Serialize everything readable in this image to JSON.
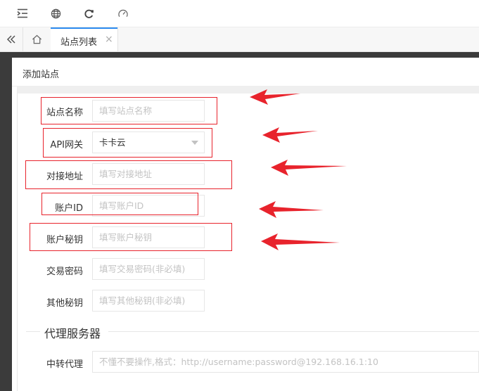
{
  "toolbar": {
    "icons": [
      "menu-indent-icon",
      "globe-icon",
      "refresh-icon",
      "dashboard-gauge-icon"
    ]
  },
  "tabs": {
    "active_label": "站点列表",
    "close_symbol": "×"
  },
  "modal": {
    "title": "添加站点",
    "fields": {
      "site_name": {
        "label": "站点名称",
        "placeholder": "填写站点名称"
      },
      "api_gateway": {
        "label": "API网关",
        "value": "卡卡云"
      },
      "endpoint": {
        "label": "对接地址",
        "placeholder": "填写对接地址"
      },
      "account_id": {
        "label": "账户ID",
        "placeholder": "填写账户ID"
      },
      "account_key": {
        "label": "账户秘钥",
        "placeholder": "填写账户秘钥"
      },
      "trade_password": {
        "label": "交易密码",
        "placeholder": "填写交易密码(非必填)"
      },
      "other_key": {
        "label": "其他秘钥",
        "placeholder": "填写其他秘钥(非必填)"
      }
    },
    "proxy_section": {
      "title": "代理服务器",
      "relay": {
        "label": "中转代理",
        "placeholder": "不懂不要操作,格式：http://username:password@192.168.16.1:10"
      }
    }
  },
  "colors": {
    "highlight_red": "#e8232c",
    "accent_blue": "#2d8cf0",
    "backdrop": "#3b3b3b"
  }
}
